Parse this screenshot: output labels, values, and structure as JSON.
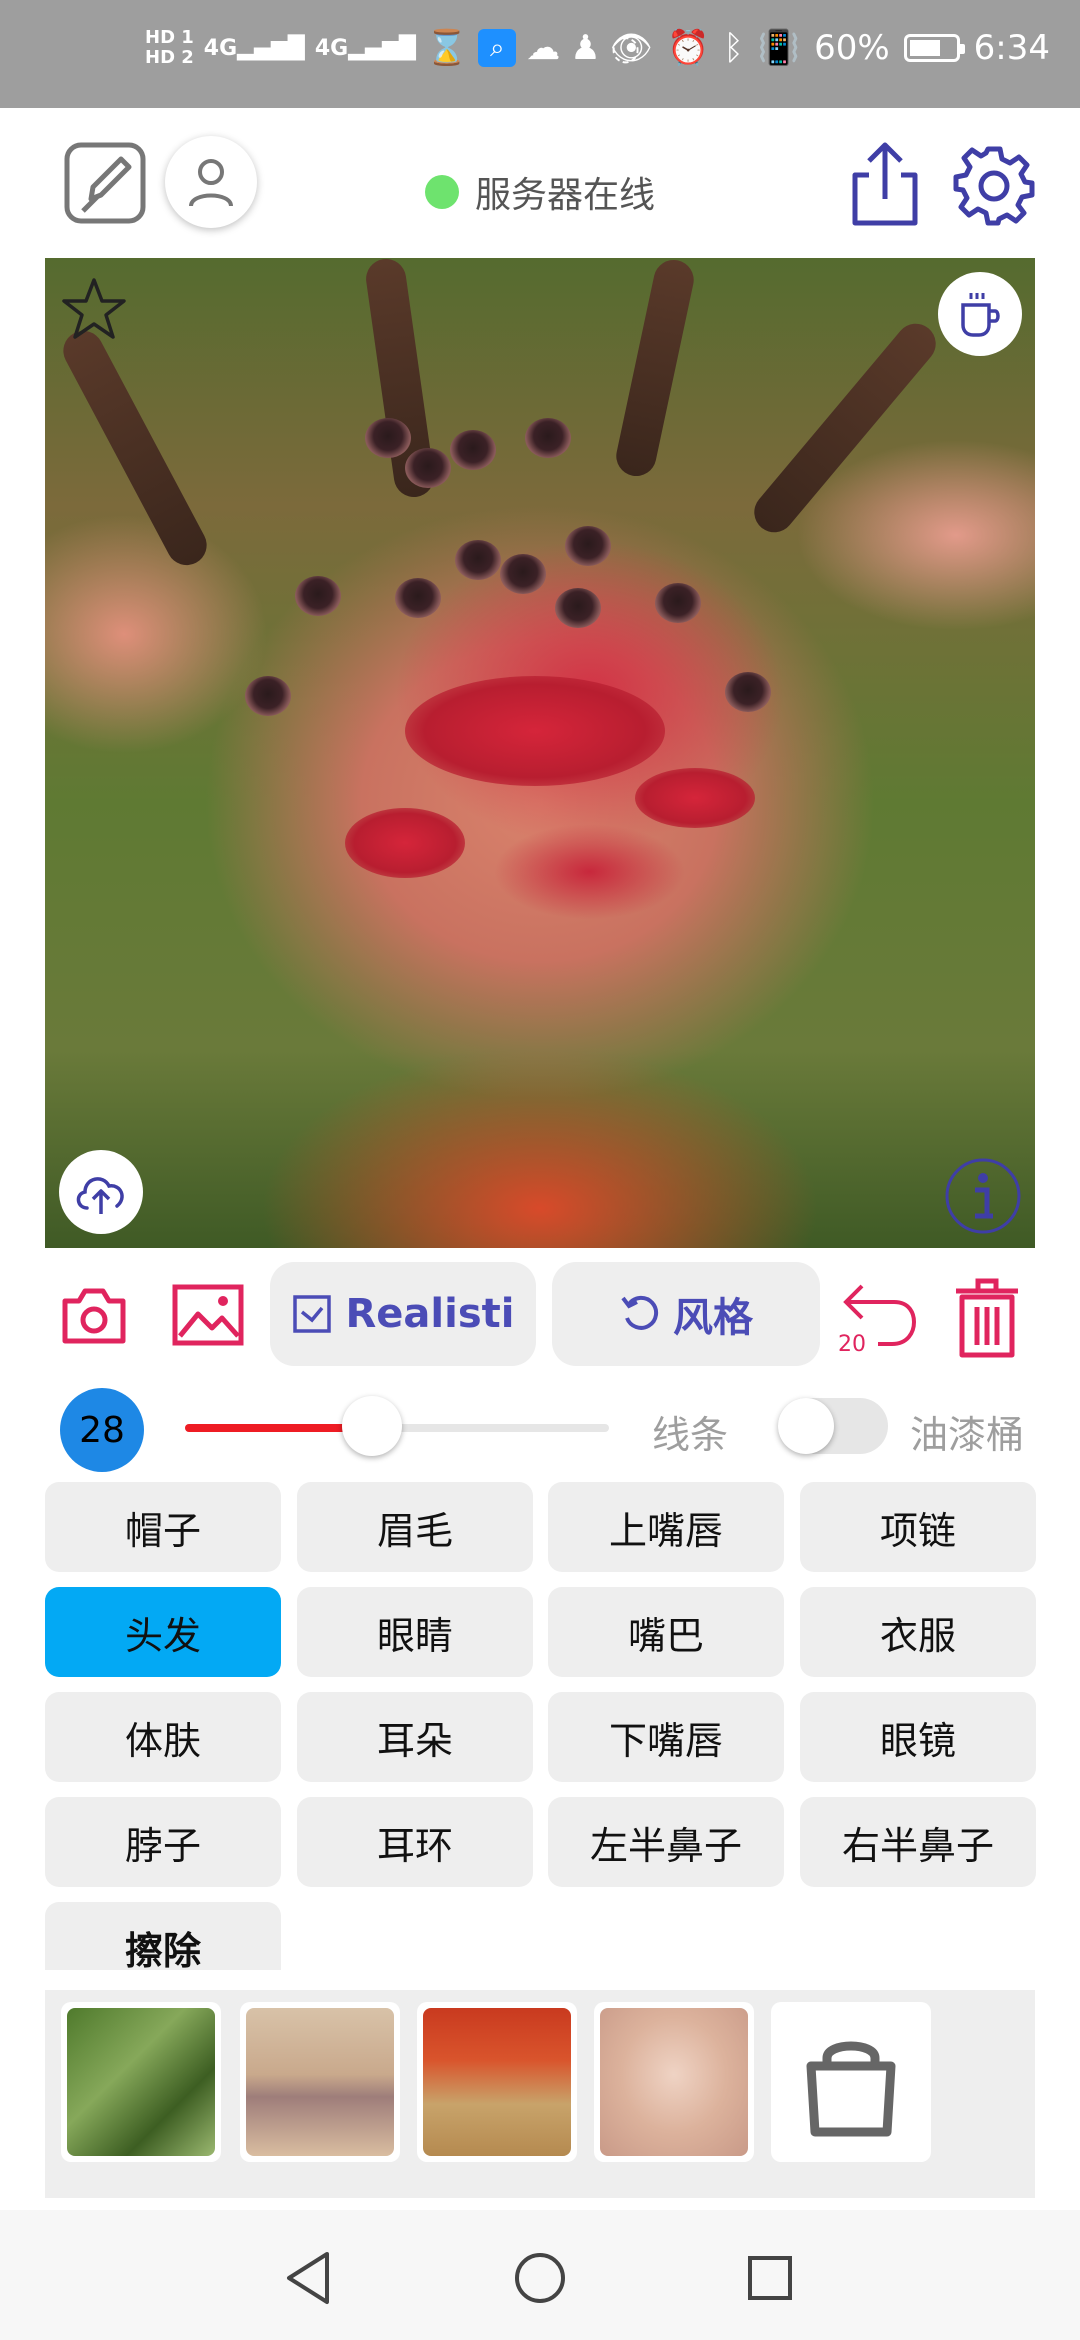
{
  "status_bar": {
    "hd1": "HD 1",
    "hd2": "HD 2",
    "net1": "4G",
    "net2": "4G",
    "battery_pct": "60%",
    "time": "6:34"
  },
  "header": {
    "server_status": "服务器在线"
  },
  "toolbar": {
    "mode_label": "Realisti",
    "style_label": "风格",
    "undo_count": "20"
  },
  "brush": {
    "size": "28",
    "slider_level": 0.44,
    "line_label": "线条",
    "bucket_label": "油漆桶",
    "bucket_enabled": false
  },
  "labels": [
    {
      "text": "帽子",
      "selected": false
    },
    {
      "text": "眉毛",
      "selected": false
    },
    {
      "text": "上嘴唇",
      "selected": false
    },
    {
      "text": "项链",
      "selected": false
    },
    {
      "text": "头发",
      "selected": true
    },
    {
      "text": "眼睛",
      "selected": false
    },
    {
      "text": "嘴巴",
      "selected": false
    },
    {
      "text": "衣服",
      "selected": false
    },
    {
      "text": "体肤",
      "selected": false
    },
    {
      "text": "耳朵",
      "selected": false
    },
    {
      "text": "下嘴唇",
      "selected": false
    },
    {
      "text": "眼镜",
      "selected": false
    },
    {
      "text": "脖子",
      "selected": false
    },
    {
      "text": "耳环",
      "selected": false
    },
    {
      "text": "左半鼻子",
      "selected": false
    },
    {
      "text": "右半鼻子",
      "selected": false
    },
    {
      "text": "擦除",
      "selected": false
    }
  ],
  "colors": {
    "accent": "#4b4cb6",
    "danger": "#e0245e",
    "selected_chip": "#03a9f4",
    "online": "#6ee36e"
  }
}
